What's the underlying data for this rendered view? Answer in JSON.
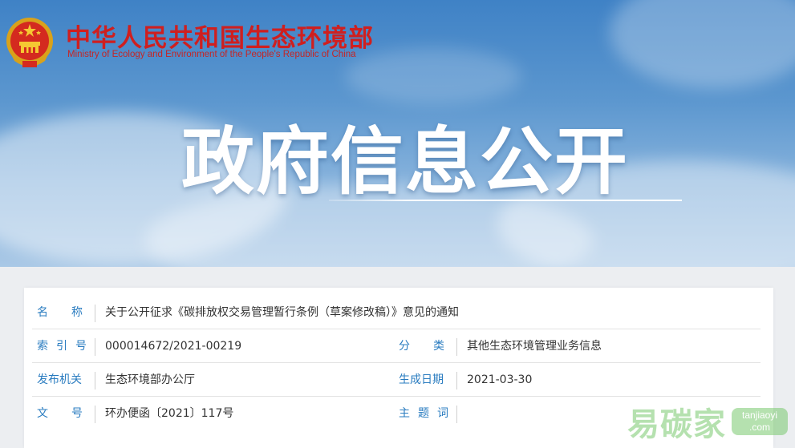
{
  "header": {
    "org_cn": "中华人民共和国生态环境部",
    "org_en": "Ministry of Ecology and Environment of the People's Republic of China",
    "hero_title": "政府信息公开",
    "emblem_icon": "national-emblem-icon",
    "brand_red": "#cf1f1f"
  },
  "info": {
    "name_label": "名称",
    "name_value": "关于公开征求《碳排放权交易管理暂行条例（草案修改稿）》意见的通知",
    "index_label": "索引号",
    "index_value": "000014672/2021-00219",
    "category_label": "分类",
    "category_value": "其他生态环境管理业务信息",
    "issuer_label": "发布机关",
    "issuer_value": "生态环境部办公厅",
    "date_label": "生成日期",
    "date_value": "2021-03-30",
    "docno_label": "文号",
    "docno_value": "环办便函〔2021〕117号",
    "topic_label": "主题词",
    "topic_value": "",
    "label_color": "#2a7cc0"
  },
  "watermark": {
    "cn": "易碳家",
    "en_line1": "tanjiaoyi",
    "en_line2": ".com"
  }
}
